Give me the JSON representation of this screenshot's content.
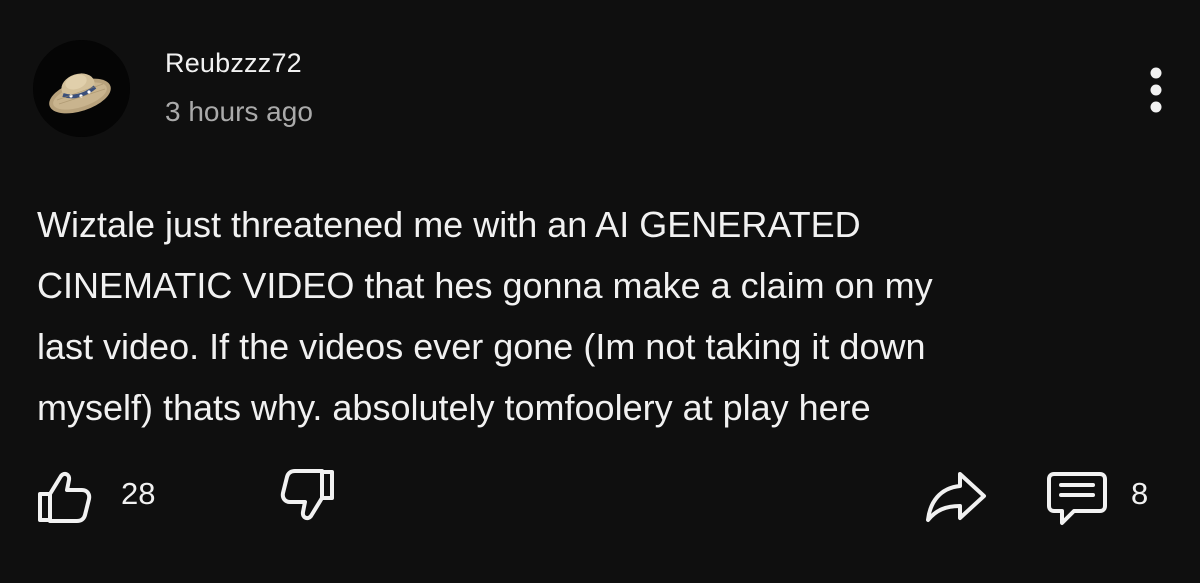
{
  "comment": {
    "author": "Reubzzz72",
    "timestamp": "3 hours ago",
    "text": "Wiztale just threatened me with an AI GENERATED\nCINEMATIC VIDEO that hes gonna make a claim on my\nlast video. If the videos ever gone (Im not taking it down\nmyself) thats why. absolutely tomfoolery at play here",
    "avatar_icon": "straw-hat-avatar",
    "like_count": "28",
    "reply_count": "8"
  },
  "icons": {
    "more": "more-vertical-icon",
    "like": "thumbs-up-icon",
    "dislike": "thumbs-down-icon",
    "share": "share-arrow-icon",
    "replies": "comment-bubble-icon"
  },
  "colors": {
    "background": "#0f0f0f",
    "primary_text": "#f1f1f1",
    "secondary_text": "#aaaaaa"
  }
}
